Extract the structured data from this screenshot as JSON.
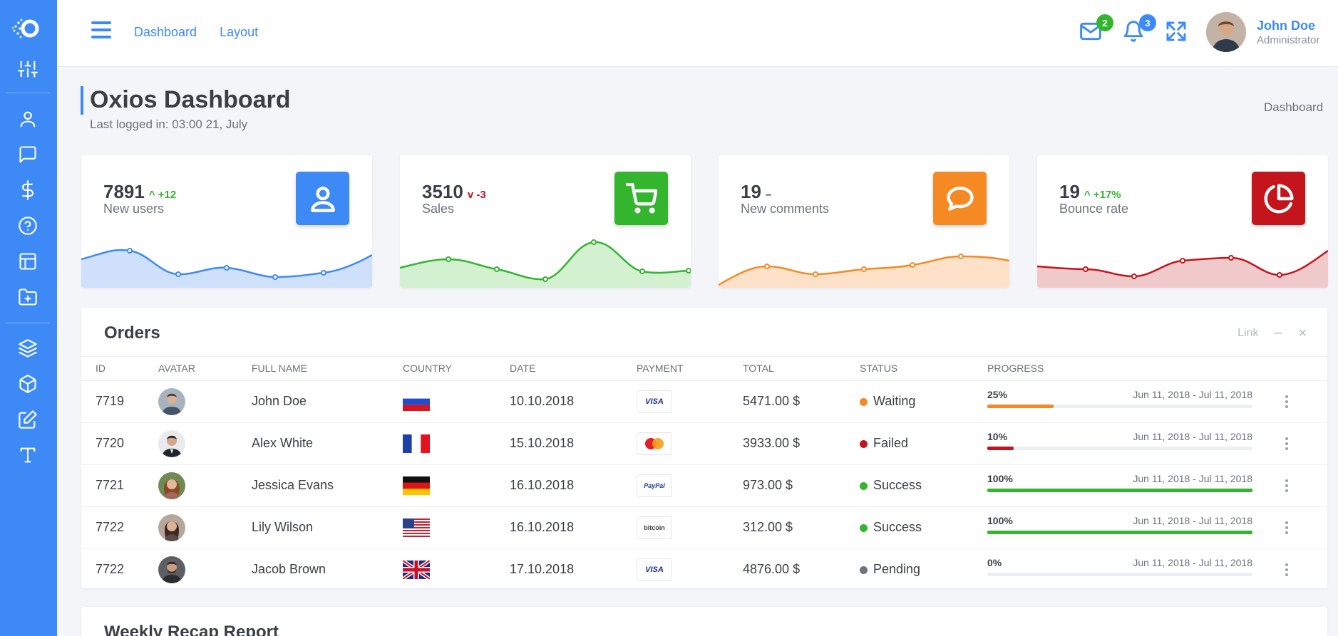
{
  "topbar": {
    "nav": [
      "Dashboard",
      "Layout"
    ],
    "mail_badge": "2",
    "bell_badge": "3",
    "user_name": "John Doe",
    "user_role": "Administrator"
  },
  "sidebar": {
    "icons": [
      "sliders-icon",
      "user-icon",
      "chat-icon",
      "dollar-icon",
      "help-icon",
      "layout-icon",
      "folder-plus-icon",
      "layers-icon",
      "box-icon",
      "edit-icon",
      "type-icon"
    ]
  },
  "page": {
    "title": "Oxios Dashboard",
    "subtitle": "Last logged in: 03:00 21, July",
    "breadcrumb": "Dashboard"
  },
  "stats": [
    {
      "value": "7891",
      "delta": "+12",
      "trend": "up",
      "label": "New users",
      "color": "#3d8af7",
      "icon": "user-icon"
    },
    {
      "value": "3510",
      "delta": "-3",
      "trend": "down",
      "label": "Sales",
      "color": "#33b52e",
      "icon": "cart-icon"
    },
    {
      "value": "19",
      "delta": "–",
      "trend": "flat",
      "label": "New comments",
      "color": "#f58a24",
      "icon": "comment-icon"
    },
    {
      "value": "19",
      "delta": "+17%",
      "trend": "up",
      "label": "Bounce rate",
      "color": "#c4151c",
      "icon": "pie-chart-icon"
    }
  ],
  "orders": {
    "title": "Orders",
    "tools": {
      "link": "Link",
      "minimize": "–",
      "close": "✕"
    },
    "columns": [
      "ID",
      "Avatar",
      "Full Name",
      "Country",
      "Date",
      "Payment",
      "Total",
      "Status",
      "Progress"
    ],
    "rows": [
      {
        "id": "7719",
        "name": "John Doe",
        "country": "russia",
        "date": "10.10.2018",
        "payment": "VISA",
        "total": "5471.00 $",
        "status": "Waiting",
        "status_color": "#f58a24",
        "progress": "25%",
        "progress_value": 25,
        "range": "Jun 11, 2018 - Jul 11, 2018"
      },
      {
        "id": "7720",
        "name": "Alex White",
        "country": "france",
        "date": "15.10.2018",
        "payment": "mastercard",
        "total": "3933.00 $",
        "status": "Failed",
        "status_color": "#c4151c",
        "progress": "10%",
        "progress_value": 10,
        "range": "Jun 11, 2018 - Jul 11, 2018"
      },
      {
        "id": "7721",
        "name": "Jessica Evans",
        "country": "germany",
        "date": "16.10.2018",
        "payment": "PayPal",
        "total": "973.00 $",
        "status": "Success",
        "status_color": "#33b52e",
        "progress": "100%",
        "progress_value": 100,
        "range": "Jun 11, 2018 - Jul 11, 2018"
      },
      {
        "id": "7722",
        "name": "Lily Wilson",
        "country": "usa",
        "date": "16.10.2018",
        "payment": "bitcoin",
        "total": "312.00 $",
        "status": "Success",
        "status_color": "#33b52e",
        "progress": "100%",
        "progress_value": 100,
        "range": "Jun 11, 2018 - Jul 11, 2018"
      },
      {
        "id": "7722",
        "name": "Jacob Brown",
        "country": "uk",
        "date": "17.10.2018",
        "payment": "VISA",
        "total": "4876.00 $",
        "status": "Pending",
        "status_color": "#6c7480",
        "progress": "0%",
        "progress_value": 0,
        "range": "Jun 11, 2018 - Jul 11, 2018"
      }
    ]
  },
  "weekly": {
    "title": "Weekly Recap Report"
  }
}
